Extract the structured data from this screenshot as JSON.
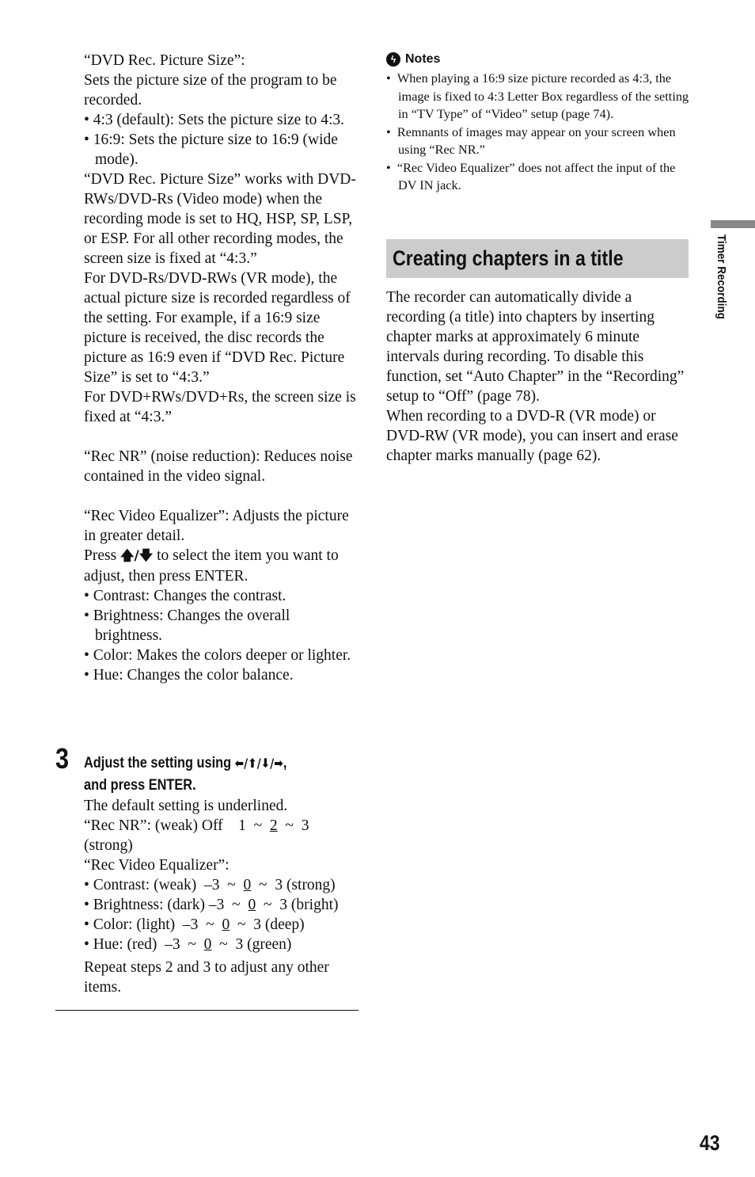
{
  "side_tab": {
    "label": "Timer Recording",
    "accent": "#888888"
  },
  "page_number": "43",
  "left_column": {
    "dvd_size_title": "“DVD Rec. Picture Size”:",
    "dvd_size_desc": "Sets the picture size of the program to be recorded.",
    "dvd_size_options": [
      "• 4:3 (default): Sets the picture size to 4:3.",
      "• 16:9: Sets the picture size to 16:9 (wide mode)."
    ],
    "dvd_size_para1": "“DVD Rec. Picture Size” works with DVD-RWs/DVD-Rs (Video mode) when the recording mode is set to HQ, HSP, SP, LSP, or ESP. For all other recording modes, the screen size is fixed at “4:3.”",
    "dvd_size_para2": "For DVD-Rs/DVD-RWs (VR mode), the actual picture size is recorded regardless of the setting. For example, if a 16:9 size picture is received, the disc records the picture as 16:9 even if “DVD Rec. Picture Size” is set to “4:3.”",
    "dvd_size_para3": "For DVD+RWs/DVD+Rs, the screen size is fixed at “4:3.”",
    "rec_nr": "“Rec NR” (noise reduction): Reduces noise contained in the video signal.",
    "rve_title": "“Rec Video Equalizer”: Adjusts the picture in greater detail.",
    "rve_press_pre": "Press ",
    "rve_press_arrows": "🡅/🡇",
    "rve_press_post": " to select the item you want to adjust, then press ENTER.",
    "rve_items": [
      "• Contrast: Changes the contrast.",
      "• Brightness: Changes the overall brightness.",
      "• Color: Makes the colors deeper or lighter.",
      "• Hue: Changes the color balance."
    ]
  },
  "step3": {
    "number": "3",
    "title_line1_pre": "Adjust the setting using ",
    "title_arrows": "⬅/⬆/⬇/➡",
    "title_line1_post": ",",
    "title_line2": "and press ENTER.",
    "default_note": "The default setting is underlined.",
    "rec_nr_pre": "“Rec NR”: (weak) Off    1  ~  ",
    "rec_nr_default": "2",
    "rec_nr_post": "  ~  3",
    "rec_nr_strong": "(strong)",
    "rve_label": "“Rec Video Equalizer”:",
    "settings": [
      {
        "pre": "• Contrast: (weak)  –3  ~  ",
        "default": "0",
        "post": "  ~  3 (strong)"
      },
      {
        "pre": "• Brightness: (dark) –3  ~  ",
        "default": "0",
        "post": "  ~  3 (bright)"
      },
      {
        "pre": "• Color: (light)  –3  ~  ",
        "default": "0",
        "post": "  ~  3 (deep)"
      },
      {
        "pre": "• Hue: (red)  –3  ~  ",
        "default": "0",
        "post": "  ~  3 (green)"
      }
    ],
    "repeat": "Repeat steps 2 and 3 to adjust any other items."
  },
  "notes": {
    "heading": "Notes",
    "icon": "notes-icon",
    "items": [
      "When playing a 16:9 size picture recorded as 4:3, the image is fixed to 4:3 Letter Box regardless of the setting in “TV Type” of “Video” setup (page 74).",
      "Remnants of images may appear on your screen when using “Rec NR.”",
      "“Rec Video Equalizer” does not affect the input of the DV IN jack."
    ]
  },
  "section": {
    "heading": "Creating chapters in a title",
    "heading_bg": "#cccccc",
    "para1": "The recorder can automatically divide a recording (a title) into chapters by inserting chapter marks at approximately 6 minute intervals during recording. To disable this function, set “Auto Chapter” in the “Recording” setup to “Off” (page 78).",
    "para2": "When recording to a DVD-R (VR mode) or DVD-RW (VR mode), you can insert and erase chapter marks manually (page 62)."
  }
}
